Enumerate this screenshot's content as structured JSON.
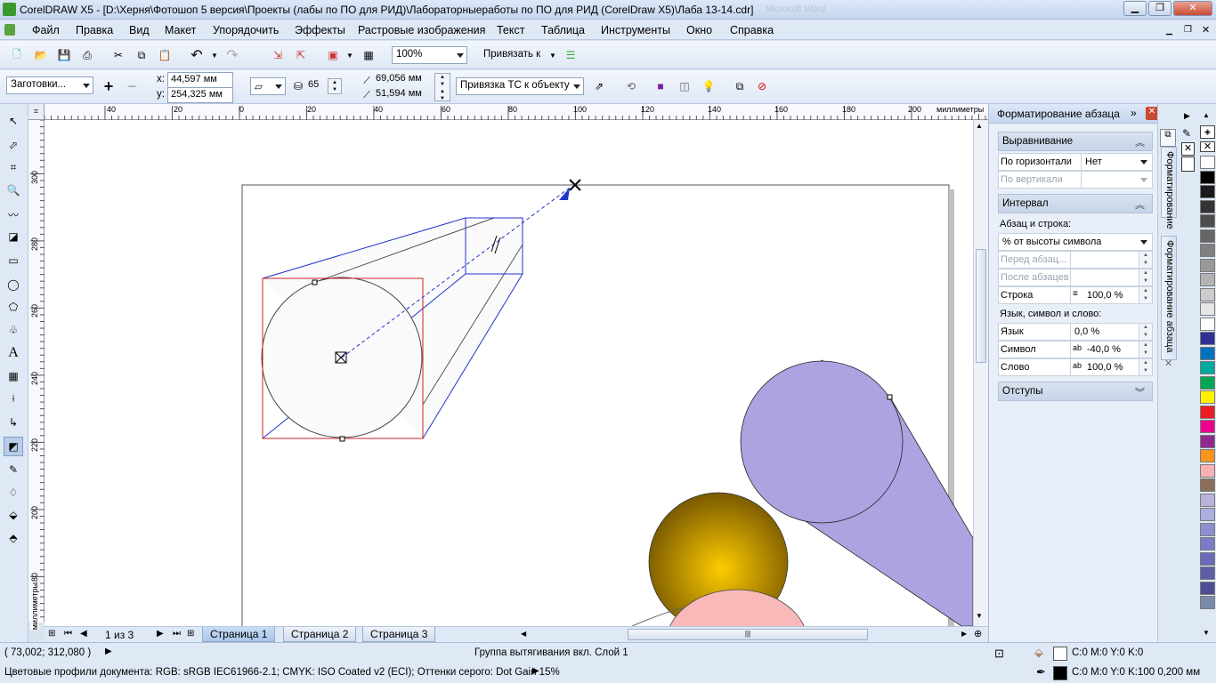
{
  "window": {
    "title": "CorelDRAW X5 - [D:\\Херня\\Фотошоп 5 версия\\Проекты (лабы по ПО для РИД)\\Лабораторныеработы по ПО для РИД (CorelDraw X5)\\Лаба 13-14.cdr]",
    "ghost_text": "Microsoft Word"
  },
  "menu": [
    "Файл",
    "Правка",
    "Вид",
    "Макет",
    "Упорядочить",
    "Эффекты",
    "Растровые изображения",
    "Текст",
    "Таблица",
    "Инструменты",
    "Окно",
    "Справка"
  ],
  "toolbar": {
    "zoom": "100%",
    "snap_label": "Привязать к"
  },
  "propbar": {
    "presets": "Заготовки...",
    "x_label": "x:",
    "x_value": "44,597 мм",
    "y_label": "y:",
    "y_value": "254,325 мм",
    "depth": "65",
    "vp_x": "69,056 мм",
    "vp_y": "51,594 мм",
    "vp_lock": "Привязка ТС к объекту"
  },
  "ruler": {
    "unit": "миллиметры",
    "top_ticks": [
      "40",
      "20",
      "0",
      "20",
      "40",
      "60",
      "80",
      "100",
      "120",
      "140",
      "160",
      "180",
      "200"
    ],
    "left_ticks": [
      "300",
      "280",
      "260",
      "240",
      "220",
      "200",
      "180"
    ]
  },
  "pages": {
    "counter": "1 из 3",
    "tabs": [
      "Страница 1",
      "Страница 2",
      "Страница 3"
    ]
  },
  "docker": {
    "title": "Форматирование абзаца",
    "align_header": "Выравнивание",
    "horiz_label": "По горизонтали",
    "horiz_value": "Нет",
    "vert_label": "По вертикали",
    "spacing_header": "Интервал",
    "para_line_label": "Абзац и строка:",
    "para_line_value": "% от высоты символа",
    "before_label": "Перед абзац...",
    "after_label": "После абзацев",
    "line_label": "Строка",
    "line_value": "100,0 %",
    "lang_header": "Язык, символ и слово:",
    "lang_label": "Язык",
    "lang_value": "0,0 %",
    "char_label": "Символ",
    "char_value": "-40,0 %",
    "word_label": "Слово",
    "word_value": "100,0 %",
    "indent_header": "Отступы"
  },
  "side_tabs": [
    "Форматирование",
    "Форматирование абзаца"
  ],
  "palette": [
    "#ffffff",
    "#000000",
    "#1a1a1a",
    "#333333",
    "#4d4d4d",
    "#666666",
    "#808080",
    "#999999",
    "#b3b3b3",
    "#cccccc",
    "#e6e6e6",
    "#ffffff",
    "#2e3192",
    "#0071bc",
    "#00a99d",
    "#00a651",
    "#fff200",
    "#ed1c24",
    "#ec008c",
    "#92278f",
    "#f7941d",
    "#f9b1b1",
    "#8c6e5a",
    "#b9b3da",
    "#aeaee0",
    "#8f8fcf",
    "#7b7bc6",
    "#6a6ab8",
    "#5d5da8",
    "#4e4e96",
    "#7a8aa8"
  ],
  "status": {
    "coords": "( 73,002; 312,080 )",
    "info": "Группа вытягивания вкл. Слой 1",
    "fill": "C:0 M:0 Y:0 K:0",
    "outline": "C:0 M:0 Y:0 K:100  0,200 мм",
    "profile": "Цветовые профили документа: RGB: sRGB IEC61966-2.1; CMYK: ISO Coated v2 (ECI); Оттенки серого: Dot Gain 15%"
  }
}
